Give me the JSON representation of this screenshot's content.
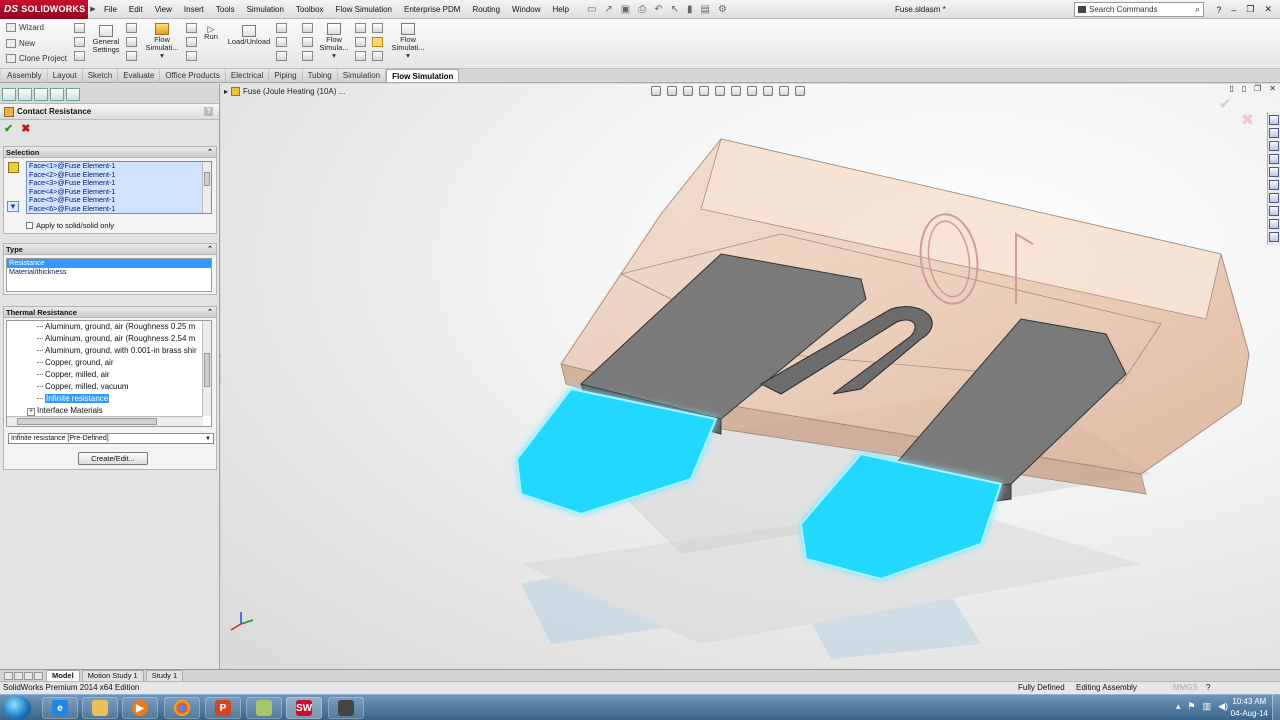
{
  "app": {
    "brand": "SOLIDWORKS",
    "brand_prefix": "DS",
    "document_title": "Fuse.sldasm *"
  },
  "menu": [
    "File",
    "Edit",
    "View",
    "Insert",
    "Tools",
    "Simulation",
    "Toolbox",
    "Flow Simulation",
    "Enterprise PDM",
    "Routing",
    "Window",
    "Help"
  ],
  "search": {
    "placeholder": "Search Commands"
  },
  "command_manager": {
    "wizard": "Wizard",
    "new": "New",
    "clone_project": "Clone Project",
    "general_settings_line1": "General",
    "general_settings_line2": "Settings",
    "flow_sim_1_line1": "Flow",
    "flow_sim_1_line2": "Simulati...",
    "run": "Run",
    "load_unload": "Load/Unload",
    "flow_sim_2_line1": "Flow",
    "flow_sim_2_line2": "Simula...",
    "flow_sim_3_line1": "Flow",
    "flow_sim_3_line2": "Simulati..."
  },
  "tabs": [
    "Assembly",
    "Layout",
    "Sketch",
    "Evaluate",
    "Office Products",
    "Electrical",
    "Piping",
    "Tubing",
    "Simulation",
    "Flow Simulation"
  ],
  "active_tab": "Flow Simulation",
  "property_manager": {
    "title": "Contact Resistance",
    "help": "?",
    "selection": {
      "header": "Selection",
      "faces": [
        "Face<1>@Fuse Element-1",
        "Face<2>@Fuse Element-1",
        "Face<3>@Fuse Element-1",
        "Face<4>@Fuse Element-1",
        "Face<5>@Fuse Element-1",
        "Face<6>@Fuse Element-1"
      ],
      "apply_solid_label": "Apply to solid/solid only"
    },
    "type": {
      "header": "Type",
      "options": [
        "Resistance",
        "Material/thickness"
      ],
      "selected": "Resistance"
    },
    "thermal_resistance": {
      "header": "Thermal Resistance",
      "items": [
        "Aluminum, ground, air (Roughness 0.25 m",
        "Aluminum, ground, air (Roughness 2.54 m",
        "Aluminum, ground, with 0.001-in brass shir",
        "Copper, ground, air",
        "Copper, milled, air",
        "Copper, milled, vacuum",
        "Infinite resistance",
        "Interface Materials"
      ],
      "selected_index": 6,
      "combo_value": "Infinite resistance [Pre-Defined]",
      "create_edit": "Create/Edit..."
    }
  },
  "graphics": {
    "breadcrumb": "Fuse  (Joule Heating (10A) ..."
  },
  "bottom_tabs": [
    "Model",
    "Motion Study 1",
    "Study 1"
  ],
  "status": {
    "edition": "SolidWorks Premium 2014 x64 Edition",
    "definition": "Fully Defined",
    "mode": "Editing Assembly",
    "units": "MMGS"
  },
  "clock": {
    "time": "10:43 AM",
    "date": "04-Aug-14"
  },
  "colors": {
    "accent": "#3399ff",
    "brand": "#c8102e",
    "fuse_body": "#e9c4a6",
    "terminal_glow": "#22d8ff"
  }
}
